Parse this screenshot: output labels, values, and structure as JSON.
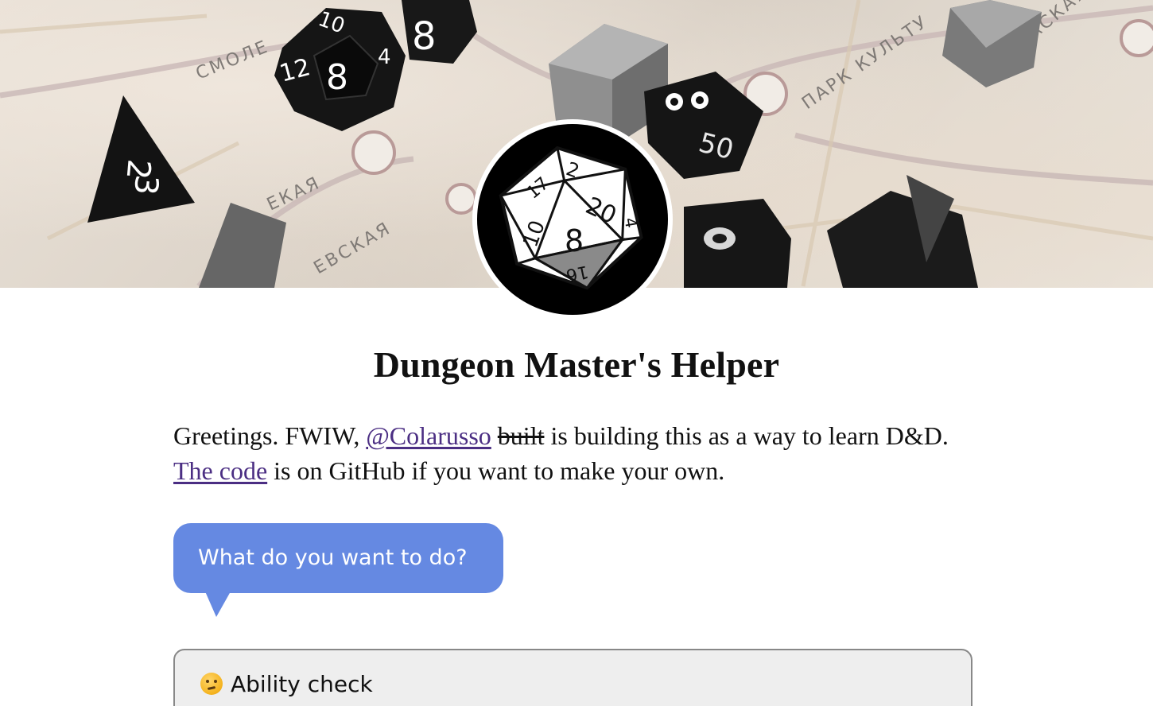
{
  "page": {
    "title": "Dungeon Master's Helper"
  },
  "hero": {
    "image_name": "dice-on-metro-map-image",
    "map_labels": [
      "СМОЛЕ",
      "ПАРК КУЛЬТУ",
      "АСКАЯ",
      "ЕКАЯ",
      "ЕВСКАЯ"
    ]
  },
  "avatar": {
    "icon": "d20-icon",
    "faces": [
      "2",
      "20",
      "10",
      "8",
      "16",
      "17",
      "4"
    ]
  },
  "intro": {
    "greeting": "Greetings. FWIW,",
    "author_link": "@Colarusso",
    "struck_word": "built",
    "middle": "is building this as a way to learn D&D.",
    "code_link": "The code",
    "ending": "is on GitHub if you want to make your own."
  },
  "prompt": {
    "text": "What do you want to do?",
    "color": "#6589e2"
  },
  "options": [
    {
      "emoji": "thinking-face-icon",
      "label": "Ability check"
    }
  ],
  "colors": {
    "link": "#4b2e83",
    "option_bg": "#eeeeee",
    "option_border": "#888888"
  }
}
